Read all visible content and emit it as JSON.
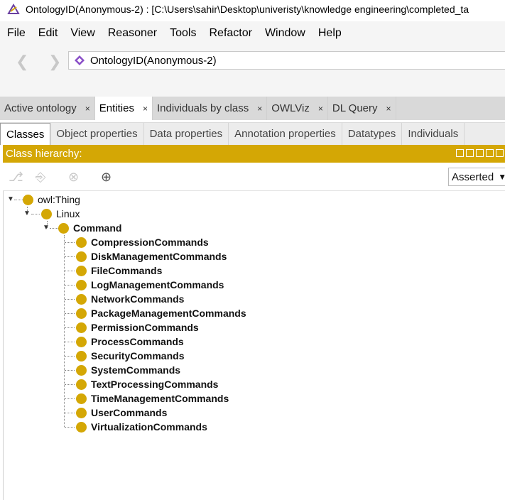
{
  "window": {
    "title": "OntologyID(Anonymous-2) : [C:\\Users\\sahir\\Desktop\\univeristy\\knowledge engineering\\completed_ta"
  },
  "menu": [
    "File",
    "Edit",
    "View",
    "Reasoner",
    "Tools",
    "Refactor",
    "Window",
    "Help"
  ],
  "nav": {
    "back_icon": "chevron-left-icon",
    "forward_icon": "chevron-right-icon",
    "ontology": "OntologyID(Anonymous-2)"
  },
  "tabs": [
    {
      "label": "Active ontology",
      "active": false
    },
    {
      "label": "Entities",
      "active": true
    },
    {
      "label": "Individuals by class",
      "active": false
    },
    {
      "label": "OWLViz",
      "active": false
    },
    {
      "label": "DL Query",
      "active": false
    }
  ],
  "tab_close": "×",
  "subtabs": [
    {
      "label": "Classes",
      "active": true
    },
    {
      "label": "Object properties",
      "active": false
    },
    {
      "label": "Data properties",
      "active": false
    },
    {
      "label": "Annotation properties",
      "active": false
    },
    {
      "label": "Datatypes",
      "active": false
    },
    {
      "label": "Individuals",
      "active": false
    }
  ],
  "view": {
    "title": "Class hierarchy:",
    "mode": "Asserted"
  },
  "colors": {
    "accent": "#d4a705",
    "class_dot": "#d4a705"
  },
  "tree": {
    "root": "owl:Thing",
    "level1": "Linux",
    "level2": "Command",
    "children": [
      "CompressionCommands",
      "DiskManagementCommands",
      "FileCommands",
      "LogManagementCommands",
      "NetworkCommands",
      "PackageManagementCommands",
      "PermissionCommands",
      "ProcessCommands",
      "SecurityCommands",
      "SystemCommands",
      "TextProcessingCommands",
      "TimeManagementCommands",
      "UserCommands",
      "VirtualizationCommands"
    ]
  }
}
